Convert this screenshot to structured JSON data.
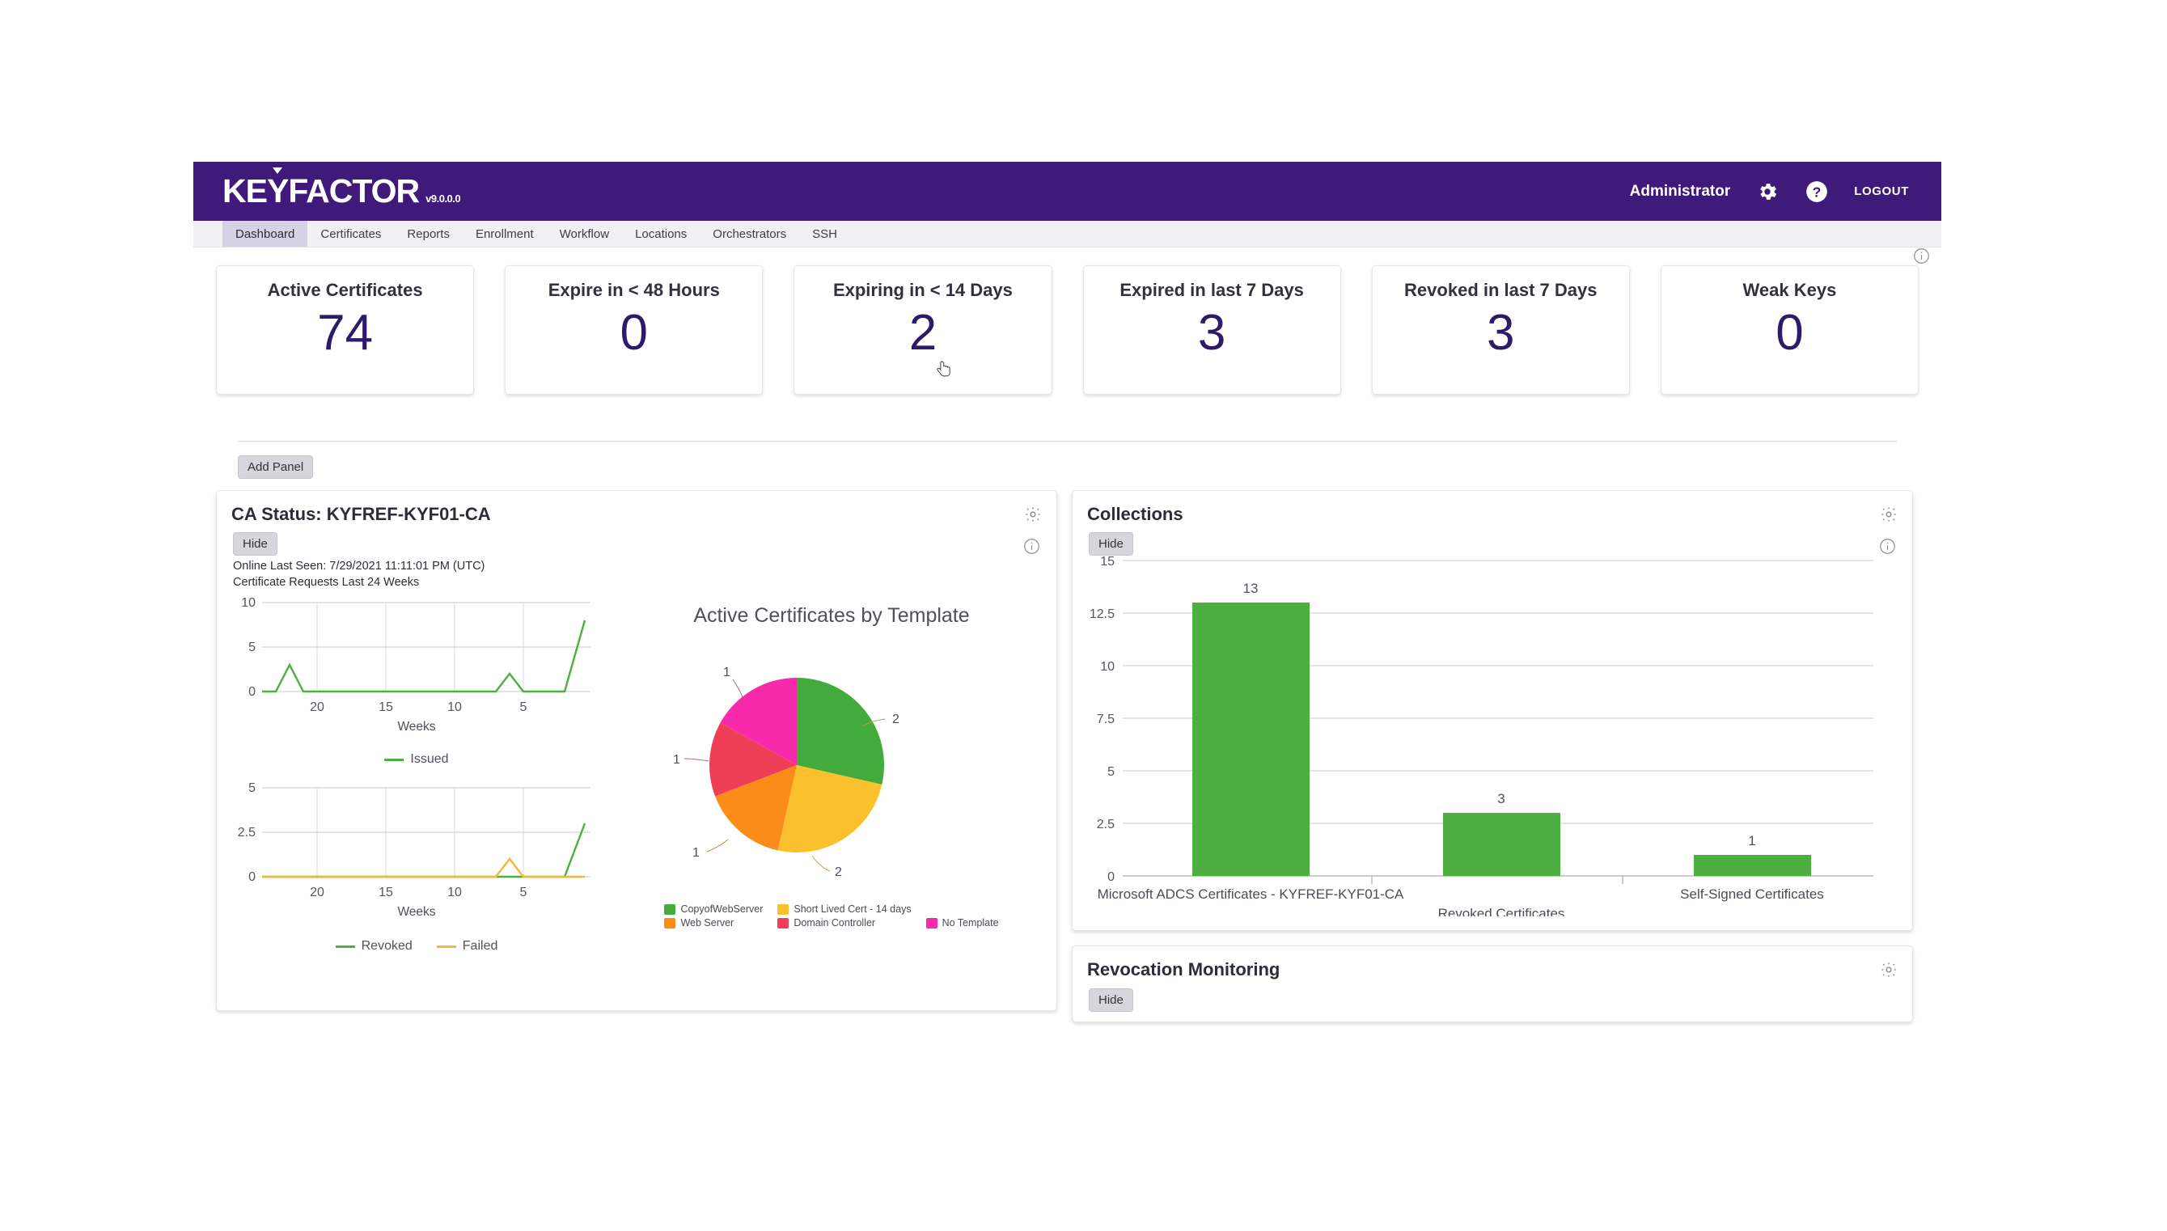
{
  "header": {
    "logo_text_1": "KE",
    "logo_text_y": "Y",
    "logo_text_2": "FACTOR",
    "version": "v9.0.0.0",
    "user": "Administrator",
    "gear_icon": "gear-icon",
    "help_icon": "help-icon",
    "logout_label": "LOGOUT",
    "brand_color": "#401a7a"
  },
  "nav": {
    "items": [
      {
        "label": "Dashboard",
        "active": true
      },
      {
        "label": "Certificates",
        "active": false
      },
      {
        "label": "Reports",
        "active": false
      },
      {
        "label": "Enrollment",
        "active": false
      },
      {
        "label": "Workflow",
        "active": false
      },
      {
        "label": "Locations",
        "active": false
      },
      {
        "label": "Orchestrators",
        "active": false
      },
      {
        "label": "SSH",
        "active": false
      }
    ]
  },
  "kpis": [
    {
      "title": "Active Certificates",
      "value": "74"
    },
    {
      "title": "Expire in < 48 Hours",
      "value": "0"
    },
    {
      "title": "Expiring in < 14 Days",
      "value": "2"
    },
    {
      "title": "Expired in last 7 Days",
      "value": "3"
    },
    {
      "title": "Revoked in last 7 Days",
      "value": "3"
    },
    {
      "title": "Weak Keys",
      "value": "0"
    }
  ],
  "toolbar": {
    "add_panel_label": "Add Panel",
    "hide_label": "Hide"
  },
  "ca_panel": {
    "title": "CA Status: KYFREF-KYF01-CA",
    "hide_label": "Hide",
    "online_last_seen": "Online Last Seen: 7/29/2021 11:11:01 PM (UTC)",
    "requests_caption": "Certificate Requests Last 24 Weeks"
  },
  "collections_panel": {
    "title": "Collections",
    "hide_label": "Hide"
  },
  "revocation_panel": {
    "title": "Revocation Monitoring"
  },
  "chart_data": [
    {
      "type": "line",
      "title": "Certificate Requests Last 24 Weeks",
      "xlabel": "Weeks",
      "ylabel": "",
      "ylim": [
        0,
        10
      ],
      "yticks": [
        0,
        5,
        10
      ],
      "xticks": [
        20,
        15,
        10,
        5
      ],
      "x_reversed": true,
      "grid": true,
      "legend": [
        "Issued"
      ],
      "legend_position": "bottom",
      "series": [
        {
          "name": "Issued",
          "color": "#4caf3f",
          "x": [
            24,
            23,
            22,
            21,
            20,
            19,
            18,
            17,
            16,
            15,
            14,
            13,
            12,
            11,
            10,
            9,
            8,
            7,
            6,
            5,
            4,
            3,
            2,
            1
          ],
          "values": [
            0,
            0,
            3,
            0,
            0,
            0,
            0,
            0,
            0,
            0,
            0,
            0,
            0,
            0,
            0,
            0,
            0,
            0,
            2,
            0,
            0,
            0,
            0,
            8
          ]
        }
      ]
    },
    {
      "type": "line",
      "title": "",
      "xlabel": "Weeks",
      "ylabel": "",
      "ylim": [
        0,
        5
      ],
      "yticks": [
        0,
        2.5,
        5
      ],
      "xticks": [
        20,
        15,
        10,
        5
      ],
      "x_reversed": true,
      "grid": true,
      "legend": [
        "Revoked",
        "Failed"
      ],
      "legend_position": "bottom",
      "series": [
        {
          "name": "Revoked",
          "color": "#4caf3f",
          "x": [
            24,
            23,
            22,
            21,
            20,
            19,
            18,
            17,
            16,
            15,
            14,
            13,
            12,
            11,
            10,
            9,
            8,
            7,
            6,
            5,
            4,
            3,
            2,
            1
          ],
          "values": [
            0,
            0,
            0,
            0,
            0,
            0,
            0,
            0,
            0,
            0,
            0,
            0,
            0,
            0,
            0,
            0,
            0,
            0,
            0,
            0,
            0,
            0,
            0,
            3
          ]
        },
        {
          "name": "Failed",
          "color": "#f2b933",
          "x": [
            24,
            23,
            22,
            21,
            20,
            19,
            18,
            17,
            16,
            15,
            14,
            13,
            12,
            11,
            10,
            9,
            8,
            7,
            6,
            5,
            4,
            3,
            2,
            1
          ],
          "values": [
            0,
            0,
            0,
            0,
            0,
            0,
            0,
            0,
            0,
            0,
            0,
            0,
            0,
            0,
            0,
            0,
            0,
            0,
            1,
            0,
            0,
            0,
            0,
            0
          ]
        }
      ]
    },
    {
      "type": "pie",
      "title": "Active Certificates by Template",
      "labels": [
        "CopyofWebServer",
        "Short Lived Cert - 14 days",
        "Web Server",
        "Domain Controller",
        "No Template"
      ],
      "values": [
        2,
        2,
        1,
        1,
        1
      ],
      "colors": [
        "#42ab3b",
        "#fbc02d",
        "#fb8c1a",
        "#ef3f57",
        "#f72aab"
      ],
      "data_labels": [
        "2",
        "2",
        "1",
        "1",
        "1"
      ],
      "legend_position": "bottom"
    },
    {
      "type": "bar",
      "title": "Collections",
      "categories": [
        "Microsoft ADCS Certificates - KYFREF-KYF01-CA",
        "Revoked Certificates",
        "Self-Signed Certificates"
      ],
      "values": [
        13,
        3,
        1
      ],
      "data_labels": [
        "13",
        "3",
        "1"
      ],
      "bar_color": "#4caf3f",
      "ylim": [
        0,
        15
      ],
      "yticks": [
        "0",
        "2.5",
        "5",
        "7.5",
        "10",
        "12.5",
        "15"
      ],
      "ytick_values": [
        0,
        2.5,
        5,
        7.5,
        10,
        12.5,
        15
      ],
      "xlabel": "",
      "ylabel": "",
      "grid": true
    }
  ]
}
